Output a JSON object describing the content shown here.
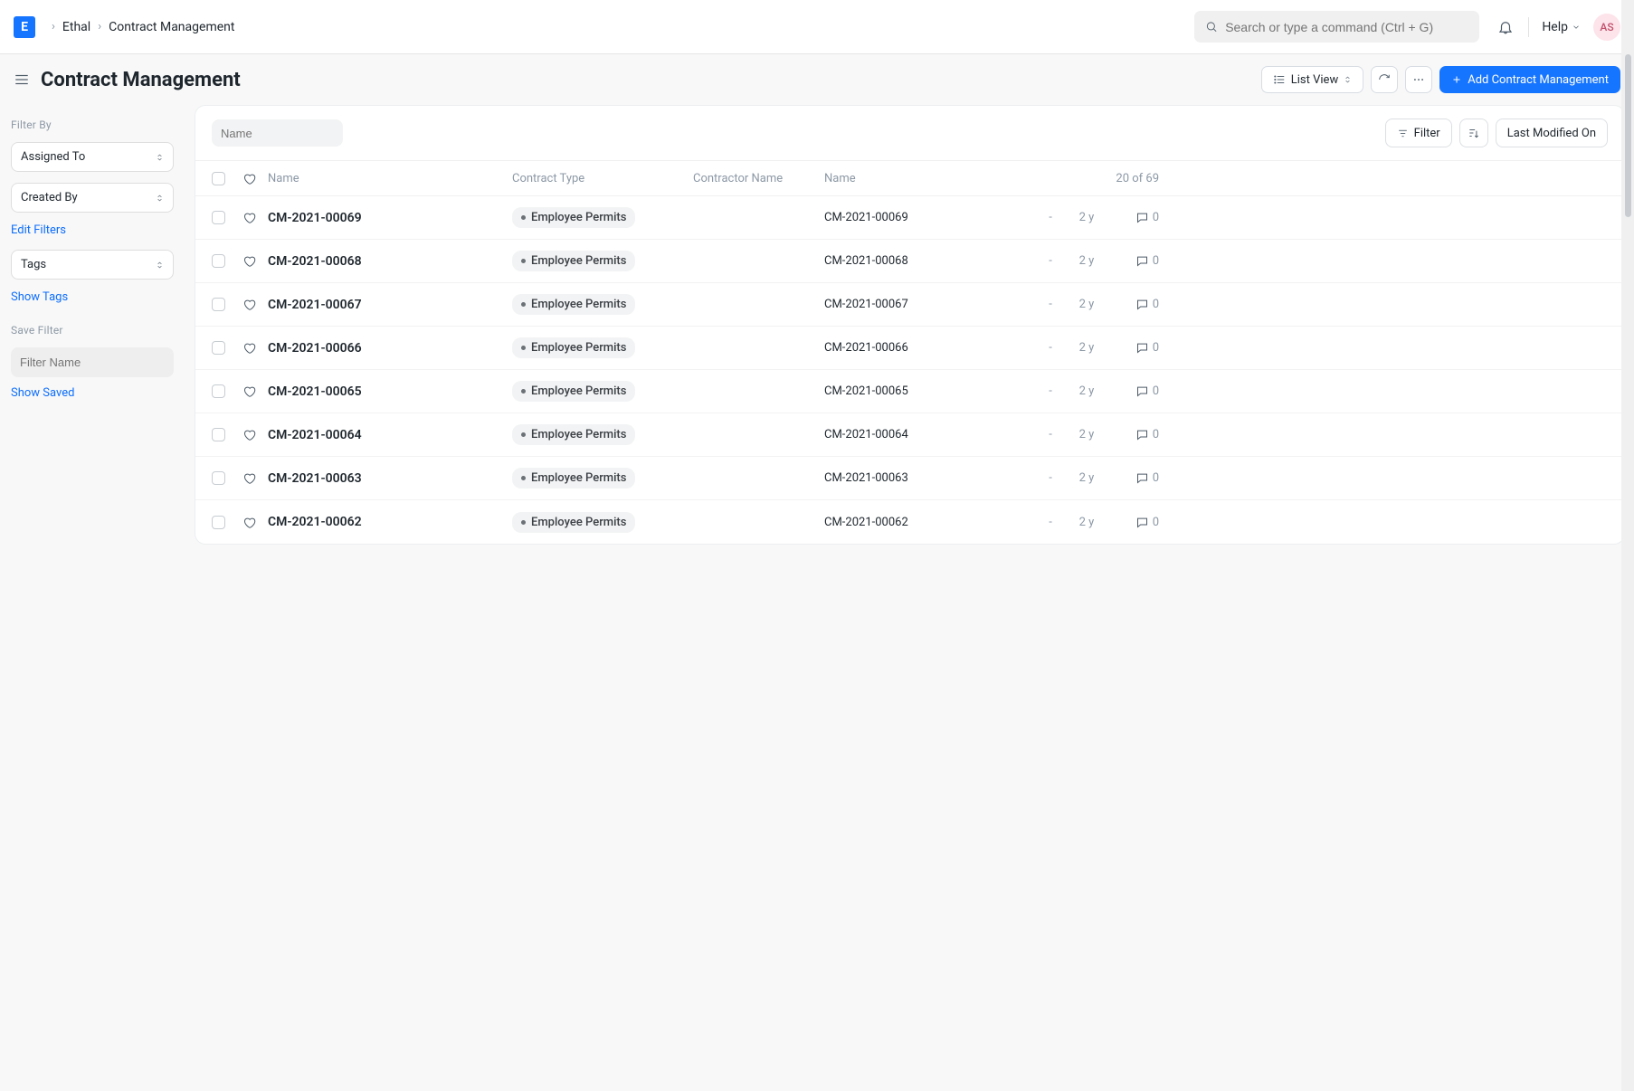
{
  "brand_letter": "E",
  "breadcrumb": {
    "root": "Ethal",
    "page": "Contract Management"
  },
  "search": {
    "placeholder": "Search or type a command (Ctrl + G)"
  },
  "help_label": "Help",
  "avatar": "AS",
  "page_title": "Contract Management",
  "view_selector": "List View",
  "add_button": "Add Contract Management",
  "sidebar": {
    "filter_by_label": "Filter By",
    "assigned_to": "Assigned To",
    "created_by": "Created By",
    "edit_filters": "Edit Filters",
    "tags": "Tags",
    "show_tags": "Show Tags",
    "save_filter_label": "Save Filter",
    "filter_name_placeholder": "Filter Name",
    "show_saved": "Show Saved"
  },
  "toolbar": {
    "name_placeholder": "Name",
    "filter": "Filter",
    "sort_label": "Last Modified On"
  },
  "columns": {
    "name": "Name",
    "contract_type": "Contract Type",
    "contractor_name": "Contractor Name",
    "name2": "Name",
    "count": "20 of 69"
  },
  "rows": [
    {
      "id": "CM-2021-00069",
      "type": "Employee Permits",
      "contractor": "",
      "name": "CM-2021-00069",
      "dash": "-",
      "age": "2 y",
      "comments": 0
    },
    {
      "id": "CM-2021-00068",
      "type": "Employee Permits",
      "contractor": "",
      "name": "CM-2021-00068",
      "dash": "-",
      "age": "2 y",
      "comments": 0
    },
    {
      "id": "CM-2021-00067",
      "type": "Employee Permits",
      "contractor": "",
      "name": "CM-2021-00067",
      "dash": "-",
      "age": "2 y",
      "comments": 0
    },
    {
      "id": "CM-2021-00066",
      "type": "Employee Permits",
      "contractor": "",
      "name": "CM-2021-00066",
      "dash": "-",
      "age": "2 y",
      "comments": 0
    },
    {
      "id": "CM-2021-00065",
      "type": "Employee Permits",
      "contractor": "",
      "name": "CM-2021-00065",
      "dash": "-",
      "age": "2 y",
      "comments": 0
    },
    {
      "id": "CM-2021-00064",
      "type": "Employee Permits",
      "contractor": "",
      "name": "CM-2021-00064",
      "dash": "-",
      "age": "2 y",
      "comments": 0
    },
    {
      "id": "CM-2021-00063",
      "type": "Employee Permits",
      "contractor": "",
      "name": "CM-2021-00063",
      "dash": "-",
      "age": "2 y",
      "comments": 0
    },
    {
      "id": "CM-2021-00062",
      "type": "Employee Permits",
      "contractor": "",
      "name": "CM-2021-00062",
      "dash": "-",
      "age": "2 y",
      "comments": 0
    }
  ]
}
